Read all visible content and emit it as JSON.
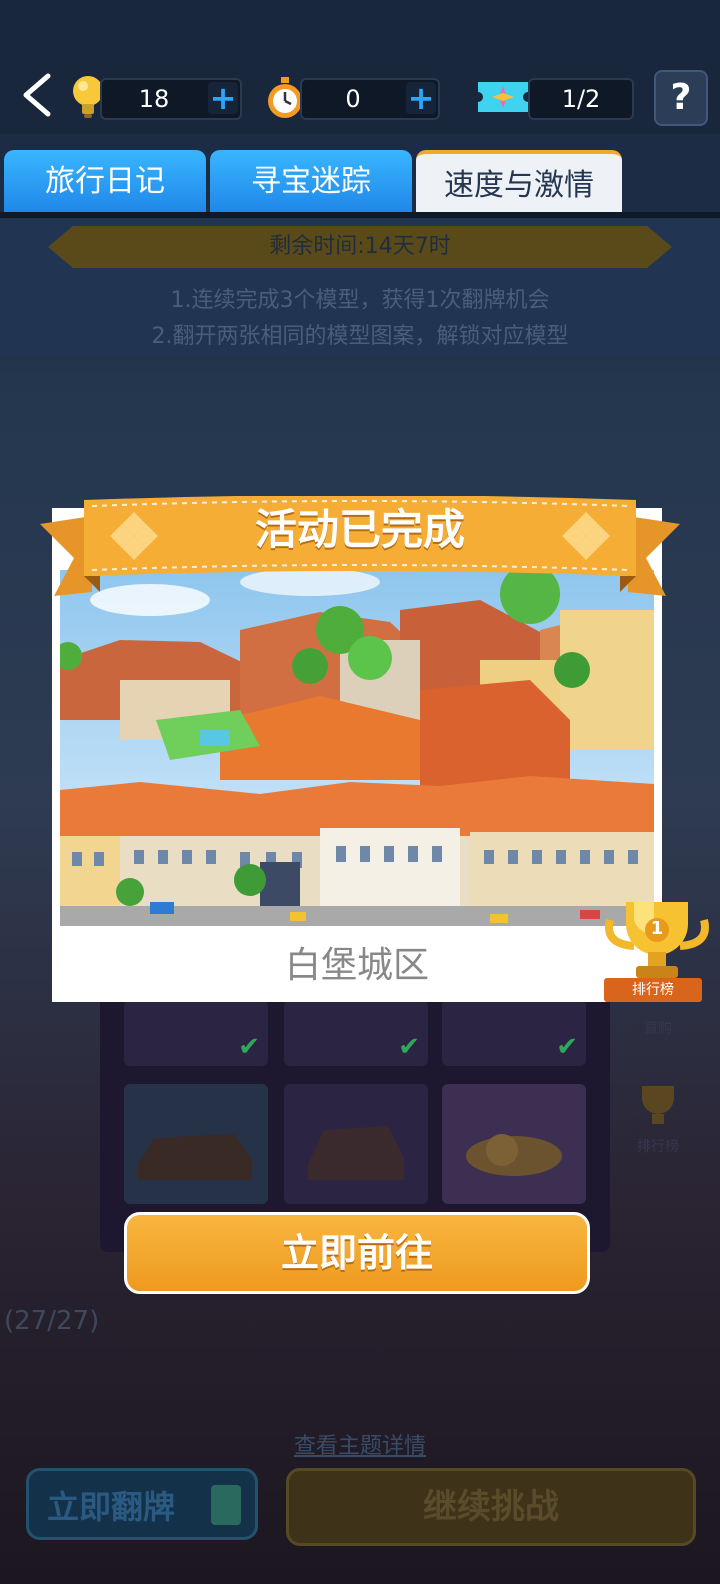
{
  "topbar": {
    "bulbs": "18",
    "timers": "0",
    "tickets": "1/2",
    "help": "?"
  },
  "tabs": [
    "旅行日记",
    "寻宝迷踪",
    "速度与激情"
  ],
  "info": {
    "remaining": "剩余时间:14天7时",
    "rule1": "1.连续完成3个模型，获得1次翻牌机会",
    "rule2": "2.翻开两张相同的模型图案，解锁对应模型"
  },
  "background": {
    "progress": "(27/27)",
    "theme_link": "查看主题详情",
    "flip_button": "立即翻牌",
    "continue_button": "继续挑战",
    "side_buy": "直购",
    "side_rank": "排行榜"
  },
  "modal": {
    "banner": "活动已完成",
    "district": "白堡城区",
    "go_button": "立即前往",
    "rank_label": "排行榜",
    "rank_number": "1"
  },
  "colors": {
    "accent_orange": "#f2a929",
    "tab_blue": "#2a9cf3"
  }
}
